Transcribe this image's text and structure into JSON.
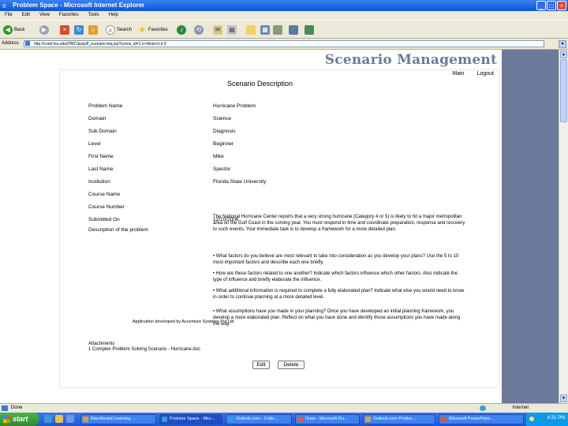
{
  "window": {
    "title": "Problem Space - Microsoft Internet Explorer"
  },
  "menu": [
    "File",
    "Edit",
    "View",
    "Favorites",
    "Tools",
    "Help"
  ],
  "toolbar": {
    "back": "Back",
    "search": "Search",
    "favorites": "Favorites"
  },
  "address": {
    "label": "Address",
    "url": "http://coeb.fsu.edu/OMC/ps/pdf_scenario-teq.jsp?scene_id=1 ic=Acterct.d 9"
  },
  "app": {
    "brand": "Scenario Management",
    "nav": {
      "main": "Main",
      "logout": "Logout"
    },
    "section_title": "Scenario Description",
    "fields": [
      {
        "label": "Problem Name",
        "value": "Hurricane Problem"
      },
      {
        "label": "Domain",
        "value": "Science"
      },
      {
        "label": "Sub Domain",
        "value": "Diagnosis"
      },
      {
        "label": "Level",
        "value": "Beginner"
      },
      {
        "label": "First Name",
        "value": "Mike"
      },
      {
        "label": "Last Name",
        "value": "Spector"
      },
      {
        "label": "Institution",
        "value": "Florida State University"
      },
      {
        "label": "Course Name",
        "value": ""
      },
      {
        "label": "Course Number",
        "value": ""
      },
      {
        "label": "Submitted On",
        "value": "12/10/2006"
      }
    ],
    "description_label": "Description of the problem",
    "description": [
      "The National Hurricane Center reports that a very strong hurricane (Category 4 or 5) is likely to hit a major metropolitan area on the Gulf Coast in the coming year. You must respond in time and coordinate preparation, response and recovery to such events. Your immediate task is to develop a framework for a more detailed plan.",
      "• What factors do you believe are most relevant to take into consideration as you develop your plans? Use the 5 to 10 most important factors and describe each one briefly.",
      "• How are these factors related to one another? Indicate which factors influence which other factors. Also indicate the type of influence and briefly elaborate the influence.",
      "• What additional information is required to complete a fully elaborated plan? Indicate what else you would need to know in order to continue planning at a more detailed level.",
      "• What assumptions have you made in your planning? Once you have developed an initial planning framework, you develop a more elaborated plan. Reflect on what you have done and identify those assumptions you have made along the way."
    ],
    "attachments_label": "Attachments",
    "attachment": "1 Complex Problem Solving Scenario - Hurricane.doc",
    "edit_label": "Edit",
    "delete_label": "Delete",
    "footer": "Application developed by Accenture Systems Pvt Ltd"
  },
  "status": {
    "left": "Done",
    "right": "Internet"
  },
  "taskbar": {
    "start": "start",
    "items": [
      "Blackboard Learning ...",
      "Problem Space - Micr...",
      "Outlook.com - Colle...",
      "Draw - Microsoft Ou...",
      "Outlook.com Produc...",
      "Microsoft PowerPoint..."
    ],
    "clock": "4:31 PM"
  },
  "colors": {
    "accent": "#6b7a9a",
    "titlebar": "#0a55d6"
  }
}
